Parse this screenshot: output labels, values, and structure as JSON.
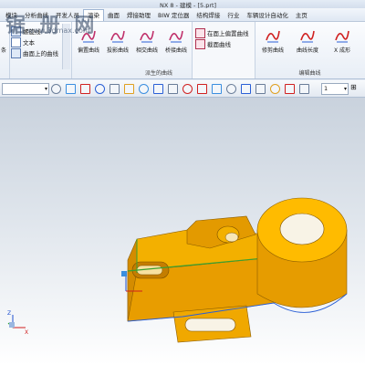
{
  "window": {
    "title": "NX 8 - 建模 - [5.prt]"
  },
  "watermark": {
    "text": "锯 册 网",
    "url": "www.3dmax.com"
  },
  "menu": {
    "tabs": [
      {
        "label": "模块"
      },
      {
        "label": "分析曲线"
      },
      {
        "label": "开发人员"
      },
      {
        "label": "渲染"
      },
      {
        "label": "曲面"
      },
      {
        "label": "焊接助理"
      },
      {
        "label": "BIW 定位器"
      },
      {
        "label": "结构焊接"
      },
      {
        "label": "行业"
      },
      {
        "label": "车辆设计自动化"
      },
      {
        "label": "主页"
      }
    ]
  },
  "ribbon": {
    "small_items": [
      {
        "label": "螺旋线",
        "icon": "helix-icon"
      },
      {
        "label": "文本",
        "icon": "text-icon"
      },
      {
        "label": "曲面上的曲线",
        "icon": "curve-on-surface-icon"
      }
    ],
    "derived_group": {
      "label": "派生的曲线",
      "buttons": [
        {
          "label": "偏置曲线",
          "icon": "offset-curve-icon"
        },
        {
          "label": "投影曲线",
          "icon": "project-curve-icon"
        },
        {
          "label": "相交曲线",
          "icon": "intersect-curve-icon"
        },
        {
          "label": "桥接曲线",
          "icon": "bridge-curve-icon"
        }
      ],
      "list_items": [
        {
          "label": "在面上偏置曲线",
          "icon": "offset-on-face-icon"
        },
        {
          "label": "截面曲线",
          "icon": "section-curve-icon"
        }
      ]
    },
    "edit_group": {
      "label": "编辑曲线",
      "buttons": [
        {
          "label": "修剪曲线",
          "icon": "trim-curve-icon"
        },
        {
          "label": "曲线长度",
          "icon": "curve-length-icon"
        },
        {
          "label": "X 成形",
          "icon": "x-form-icon"
        }
      ]
    },
    "left_label": "条"
  },
  "toolbar": {
    "filter_value": "",
    "count_value": "1"
  },
  "viewport": {
    "triad_labels": {
      "x": "X",
      "y": "Y",
      "z": "Z"
    },
    "part_color": "#f0a800",
    "background_top": "#c9d2dd",
    "background_bottom": "#ffffff"
  }
}
